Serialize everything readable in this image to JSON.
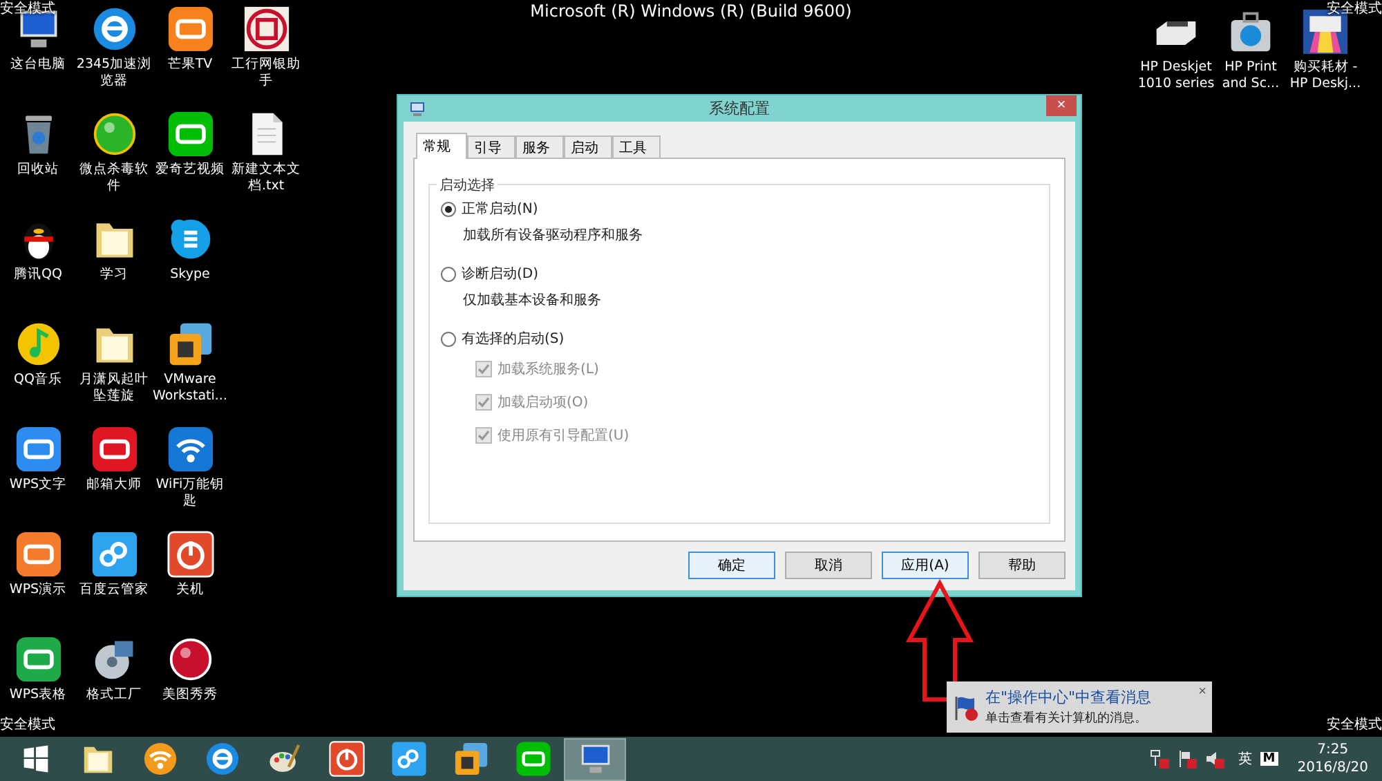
{
  "system_banner": "Microsoft (R) Windows (R) (Build 9600)",
  "mode_labels": [
    "安全模式",
    "安全模式",
    "安全模式",
    "安全模式"
  ],
  "desktop": {
    "columns": [
      [
        {
          "label": "这台电脑",
          "kind": "computer"
        },
        {
          "label": "回收站",
          "kind": "trash"
        },
        {
          "label": "腾讯QQ",
          "kind": "penguin"
        },
        {
          "label": "QQ音乐",
          "kind": "music"
        },
        {
          "label": "WPS文字",
          "kind": "blue-app"
        },
        {
          "label": "WPS演示",
          "kind": "orange-app"
        },
        {
          "label": "WPS表格",
          "kind": "green-app"
        }
      ],
      [
        {
          "label": "2345加速浏览器",
          "kind": "globe"
        },
        {
          "label": "微点杀毒软件",
          "kind": "green-orb"
        },
        {
          "label": "学习",
          "kind": "folder"
        },
        {
          "label": "月潇风起叶坠莲旋",
          "kind": "folder"
        },
        {
          "label": "邮箱大师",
          "kind": "red-app"
        },
        {
          "label": "百度云管家",
          "kind": "cloud"
        },
        {
          "label": "格式工厂",
          "kind": "disc"
        }
      ],
      [
        {
          "label": "芒果TV",
          "kind": "orange-tv"
        },
        {
          "label": "爱奇艺视频",
          "kind": "green-tv"
        },
        {
          "label": "Skype",
          "kind": "chat"
        },
        {
          "label": "VMware Workstati...",
          "kind": "squares"
        },
        {
          "label": "WiFi万能钥匙",
          "kind": "wifi"
        },
        {
          "label": "关机",
          "kind": "power"
        },
        {
          "label": "美图秀秀",
          "kind": "red-orb"
        }
      ],
      [
        {
          "label": "工行网银助手",
          "kind": "bank"
        },
        {
          "label": "新建文本文档.txt",
          "kind": "document"
        }
      ]
    ],
    "right_icons": [
      {
        "label": "HP Deskjet 1010 series",
        "kind": "printer"
      },
      {
        "label": "HP Print and Sc...",
        "kind": "case"
      },
      {
        "label": "购买耗材 - HP Deskj...",
        "kind": "color-printer"
      }
    ]
  },
  "dialog": {
    "title": "系统配置",
    "close": "×",
    "tabs": [
      {
        "label": "常规",
        "selected": true
      },
      {
        "label": "引导",
        "selected": false
      },
      {
        "label": "服务",
        "selected": false
      },
      {
        "label": "启动",
        "selected": false
      },
      {
        "label": "工具",
        "selected": false
      }
    ],
    "group_title": "启动选择",
    "options": [
      {
        "label": "正常启动(N)",
        "selected": true,
        "description": "加载所有设备驱动程序和服务"
      },
      {
        "label": "诊断启动(D)",
        "selected": false,
        "description": "仅加载基本设备和服务"
      },
      {
        "label": "有选择的启动(S)",
        "selected": false
      }
    ],
    "checkboxes": [
      {
        "label": "加载系统服务(L)",
        "checked": true,
        "disabled": true
      },
      {
        "label": "加载启动项(O)",
        "checked": true,
        "disabled": true
      },
      {
        "label": "使用原有引导配置(U)",
        "checked": true,
        "disabled": true
      }
    ],
    "buttons": [
      {
        "label": "确定",
        "highlighted": true
      },
      {
        "label": "取消",
        "highlighted": false
      },
      {
        "label": "应用(A)",
        "highlighted": true
      },
      {
        "label": "帮助",
        "highlighted": false
      }
    ]
  },
  "notification": {
    "title": "在\"操作中心\"中查看消息",
    "message": "单击查看有关计算机的消息。",
    "close": "×"
  },
  "taskbar": {
    "items": [
      {
        "kind": "start",
        "selected": false
      },
      {
        "kind": "folder",
        "selected": false
      },
      {
        "kind": "wifi",
        "selected": false
      },
      {
        "kind": "globe",
        "selected": false
      },
      {
        "kind": "palette",
        "selected": false
      },
      {
        "kind": "power",
        "selected": false
      },
      {
        "kind": "cloud",
        "selected": false
      },
      {
        "kind": "squares",
        "selected": false
      },
      {
        "kind": "green-tv",
        "selected": false
      },
      {
        "kind": "monitor",
        "selected": true
      }
    ],
    "tray": {
      "language": "英",
      "ime": "M",
      "time": "7:25",
      "date": "2016/8/20"
    }
  }
}
